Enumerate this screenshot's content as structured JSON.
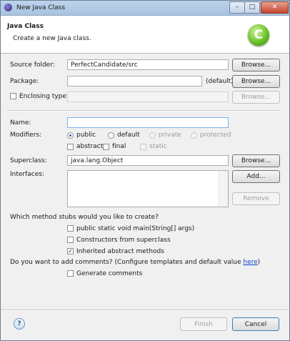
{
  "window": {
    "title": "New Java Class",
    "controls": {
      "minimize": "–",
      "maximize": "□",
      "close": "✕"
    }
  },
  "header": {
    "title": "Java Class",
    "description": "Create a new Java class.",
    "logo_glyph": "C"
  },
  "source_folder": {
    "label": "Source folder:",
    "value": "PerfectCandidate/src",
    "button": "Browse..."
  },
  "package": {
    "label": "Package:",
    "value": "",
    "default_note": "(default)",
    "button": "Browse..."
  },
  "enclosing_type": {
    "label": "Enclosing type:",
    "checked": false,
    "value": "",
    "button": "Browse..."
  },
  "name": {
    "label": "Name:",
    "value": ""
  },
  "modifiers": {
    "label": "Modifiers:",
    "access": [
      {
        "label": "public",
        "selected": true,
        "enabled": true
      },
      {
        "label": "default",
        "selected": false,
        "enabled": true
      },
      {
        "label": "private",
        "selected": false,
        "enabled": false
      },
      {
        "label": "protected",
        "selected": false,
        "enabled": false
      }
    ],
    "flags": [
      {
        "label": "abstract",
        "checked": false,
        "enabled": true
      },
      {
        "label": "final",
        "checked": false,
        "enabled": true
      },
      {
        "label": "static",
        "checked": false,
        "enabled": false
      }
    ]
  },
  "superclass": {
    "label": "Superclass:",
    "value": "java.lang.Object",
    "button": "Browse..."
  },
  "interfaces": {
    "label": "Interfaces:",
    "add_button": "Add...",
    "remove_button": "Remove"
  },
  "stubs": {
    "question": "Which method stubs would you like to create?",
    "options": [
      {
        "label": "public static void main(String[] args)",
        "checked": false
      },
      {
        "label": "Constructors from superclass",
        "checked": false
      },
      {
        "label": "Inherited abstract methods",
        "checked": true
      }
    ]
  },
  "comments": {
    "question": "Do you want to add comments? (Configure templates and default value ",
    "link": "here",
    "question_end": ")",
    "option": {
      "label": "Generate comments",
      "checked": false
    }
  },
  "footer": {
    "help_glyph": "?",
    "finish": "Finish",
    "cancel": "Cancel"
  }
}
